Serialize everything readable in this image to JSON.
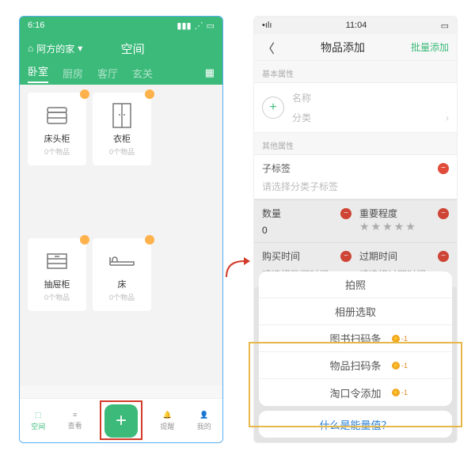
{
  "left": {
    "status_time": "6:16",
    "home_label": "阿方的家",
    "title": "空间",
    "tabs": [
      "卧室",
      "厨房",
      "客厅",
      "玄关"
    ],
    "cards": [
      {
        "title": "床头柜",
        "sub": "0个物品"
      },
      {
        "title": "衣柜",
        "sub": "0个物品"
      },
      {
        "title": "抽屉柜",
        "sub": "0个物品"
      },
      {
        "title": "床",
        "sub": "0个物品"
      }
    ],
    "tabbar": {
      "space": "空间",
      "view": "查看",
      "remind": "提醒",
      "mine": "我的"
    }
  },
  "right": {
    "status_time": "11:04",
    "title": "物品添加",
    "action": "批量添加",
    "section_basic": "基本属性",
    "field_name": "名称",
    "field_category": "分类",
    "section_other": "其他属性",
    "sub_tag_title": "子标签",
    "sub_tag_hint": "请选择分类子标签",
    "qty_title": "数量",
    "qty_value": "0",
    "importance_title": "重要程度",
    "buy_time_title": "购买时间",
    "buy_time_hint": "请选择购买时间",
    "expire_title": "过期时间",
    "expire_hint": "请选择过期时间",
    "sheet": {
      "photo": "拍照",
      "album": "相册选取",
      "book_scan": "图书扫码条",
      "item_scan": "物品扫码条",
      "tao_add": "淘口令添加",
      "badge_text": "-1",
      "footer": "什么是能量值？"
    }
  }
}
